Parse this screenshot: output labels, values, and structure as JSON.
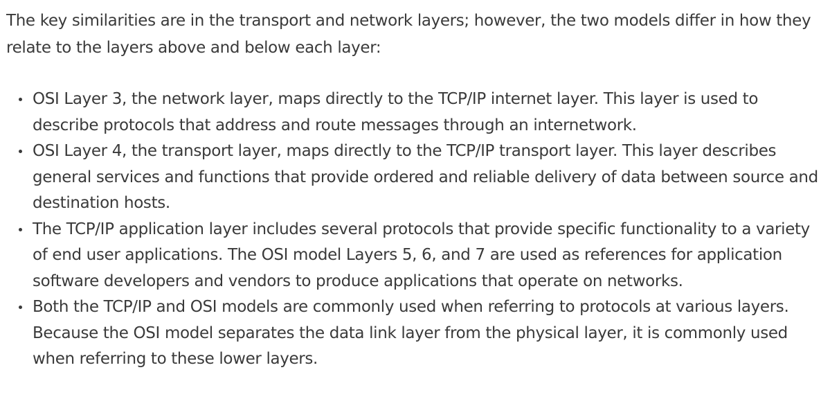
{
  "intro": "The key similarities are in the transport and network layers; however, the two models differ in how they relate to the layers above and below each layer:",
  "bullets": [
    "OSI Layer 3, the network layer, maps directly to the TCP/IP internet layer. This layer is used to describe protocols that address and route messages through an internetwork.",
    "OSI Layer 4, the transport layer, maps directly to the TCP/IP transport layer. This layer describes general services and functions that provide ordered and reliable delivery of data between source and destination hosts.",
    "The TCP/IP application layer includes several protocols that provide specific functionality to a variety of end user applications. The OSI model Layers 5, 6, and 7 are used as references for application software developers and vendors to produce applications that operate on networks.",
    "Both the TCP/IP and OSI models are commonly used when referring to protocols at various layers. Because the OSI model separates the data link layer from the physical layer, it is commonly used when referring to these lower layers."
  ]
}
